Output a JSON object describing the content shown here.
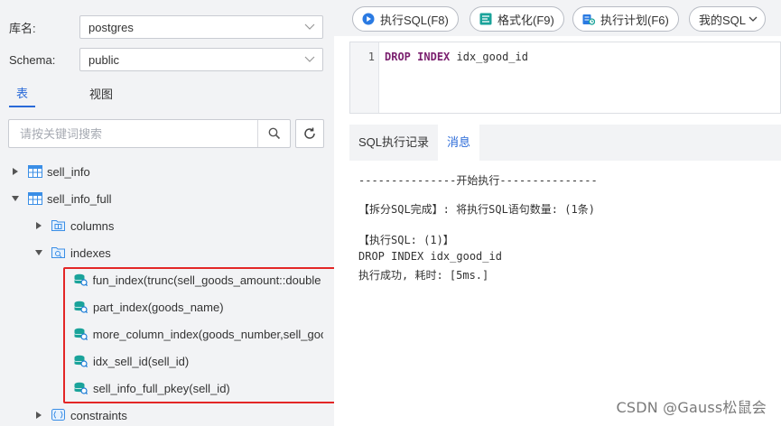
{
  "sidebar": {
    "db_label": "库名:",
    "db_value": "postgres",
    "schema_label": "Schema:",
    "schema_value": "public",
    "tabs": [
      {
        "label": "表",
        "active": true
      },
      {
        "label": "视图",
        "active": false
      }
    ],
    "search_placeholder": "请按关键词搜索",
    "tree": {
      "sell_info": "sell_info",
      "sell_info_full": "sell_info_full",
      "columns": "columns",
      "indexes": "indexes",
      "index_items": [
        "fun_index(trunc(sell_goods_amount::double p",
        "part_index(goods_name)",
        "more_column_index(goods_number,sell_goo",
        "idx_sell_id(sell_id)",
        "sell_info_full_pkey(sell_id)"
      ],
      "constraints": "constraints"
    }
  },
  "toolbar": {
    "run_sql": "执行SQL(F8)",
    "format": "格式化(F9)",
    "plan": "执行计划(F6)",
    "my_sql": "我的SQL"
  },
  "editor": {
    "line_number": "1",
    "keyword1": "DROP",
    "keyword2": "INDEX",
    "rest": " idx_good_id"
  },
  "output_tabs": [
    {
      "label": "SQL执行记录",
      "active": false
    },
    {
      "label": "消息",
      "active": true
    }
  ],
  "output_lines": [
    "---------------开始执行---------------",
    "【拆分SQL完成】: 将执行SQL语句数量: (1条)",
    "【执行SQL: (1)】",
    "DROP INDEX idx_good_id",
    "执行成功, 耗时: [5ms.]"
  ],
  "watermark": "CSDN @Gauss松鼠会",
  "colors": {
    "accent": "#2a6ad8",
    "highlight": "#e32626",
    "panel_bg": "#f2f3f5"
  }
}
